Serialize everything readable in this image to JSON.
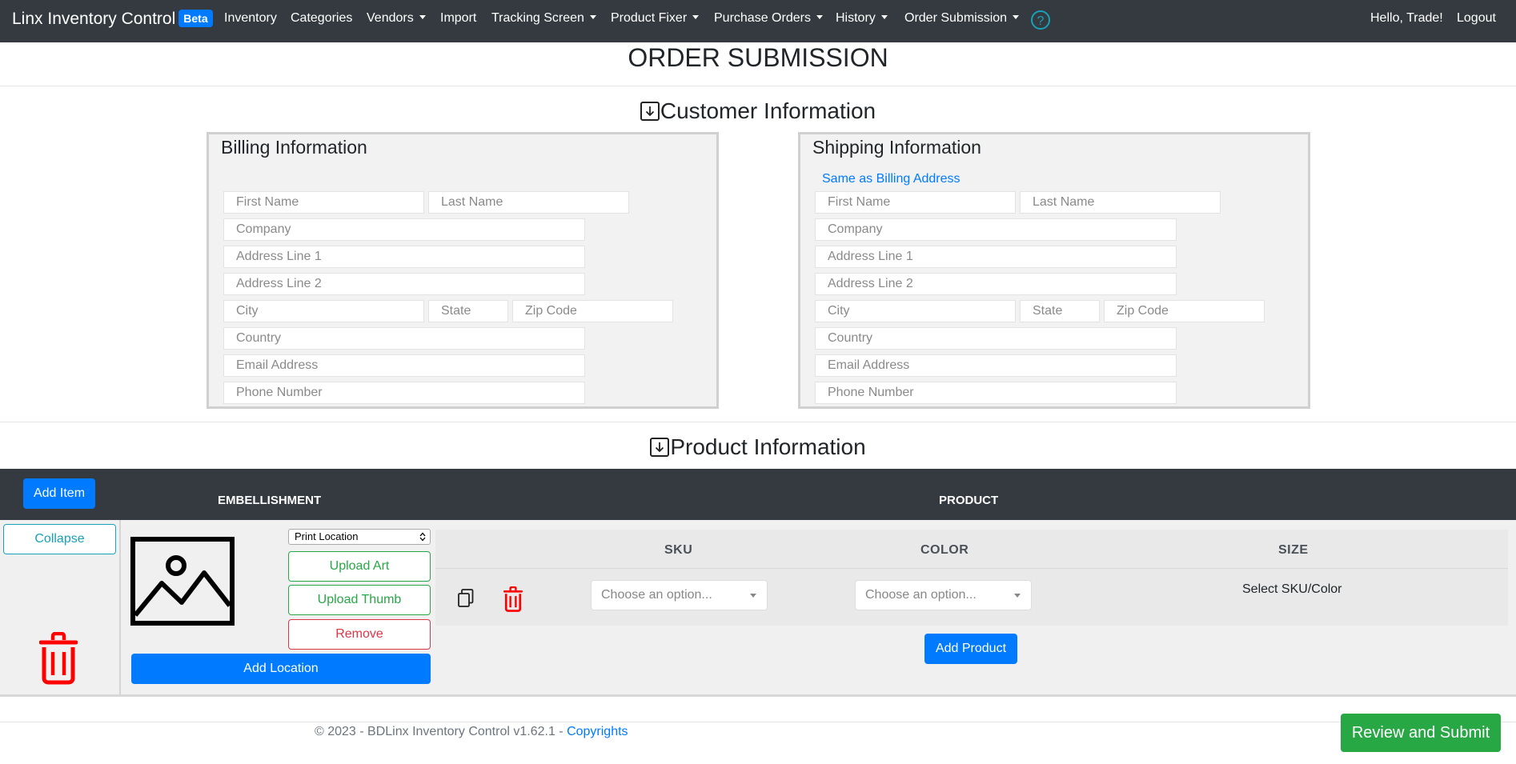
{
  "nav": {
    "brand": "Linx Inventory Control",
    "badge": "Beta",
    "items": [
      "Inventory",
      "Categories",
      "Vendors",
      "Import",
      "Tracking Screen",
      "Product Fixer",
      "Purchase Orders",
      "History",
      "Order Submission"
    ],
    "help": "?",
    "greeting": "Hello, Trade!",
    "logout": "Logout"
  },
  "page_title": "ORDER SUBMISSION",
  "customer": {
    "heading": "Customer Information",
    "billing": {
      "title": "Billing Information",
      "placeholders": {
        "first_name": "First Name",
        "last_name": "Last Name",
        "company": "Company",
        "address1": "Address Line 1",
        "address2": "Address Line 2",
        "city": "City",
        "state": "State",
        "zip": "Zip Code",
        "country": "Country",
        "email": "Email Address",
        "phone": "Phone Number"
      }
    },
    "shipping": {
      "title": "Shipping Information",
      "same_as_billing": "Same as Billing Address",
      "placeholders": {
        "first_name": "First Name",
        "last_name": "Last Name",
        "company": "Company",
        "address1": "Address Line 1",
        "address2": "Address Line 2",
        "city": "City",
        "state": "State",
        "zip": "Zip Code",
        "country": "Country",
        "email": "Email Address",
        "phone": "Phone Number"
      }
    }
  },
  "product": {
    "heading": "Product Information",
    "add_item": "Add Item",
    "embellishment_label": "EMBELLISHMENT",
    "product_label": "PRODUCT",
    "collapse": "Collapse",
    "print_location": "Print Location",
    "upload_art": "Upload Art",
    "upload_thumb": "Upload Thumb",
    "remove": "Remove",
    "add_location": "Add Location",
    "columns": {
      "sku": "SKU",
      "color": "COLOR",
      "size": "SIZE"
    },
    "sku_select": "Choose an option...",
    "color_select": "Choose an option...",
    "size_text": "Select SKU/Color",
    "add_product": "Add Product"
  },
  "footer": {
    "text": "© 2023 - BDLinx Inventory Control v1.62.1 - ",
    "link": "Copyrights"
  },
  "submit": "Review and Submit",
  "colors": {
    "navbar": "#343a40",
    "primary": "#007bff",
    "success": "#28a745",
    "danger": "#dc3545",
    "info": "#17a2b8",
    "trash": "#ff0000"
  }
}
